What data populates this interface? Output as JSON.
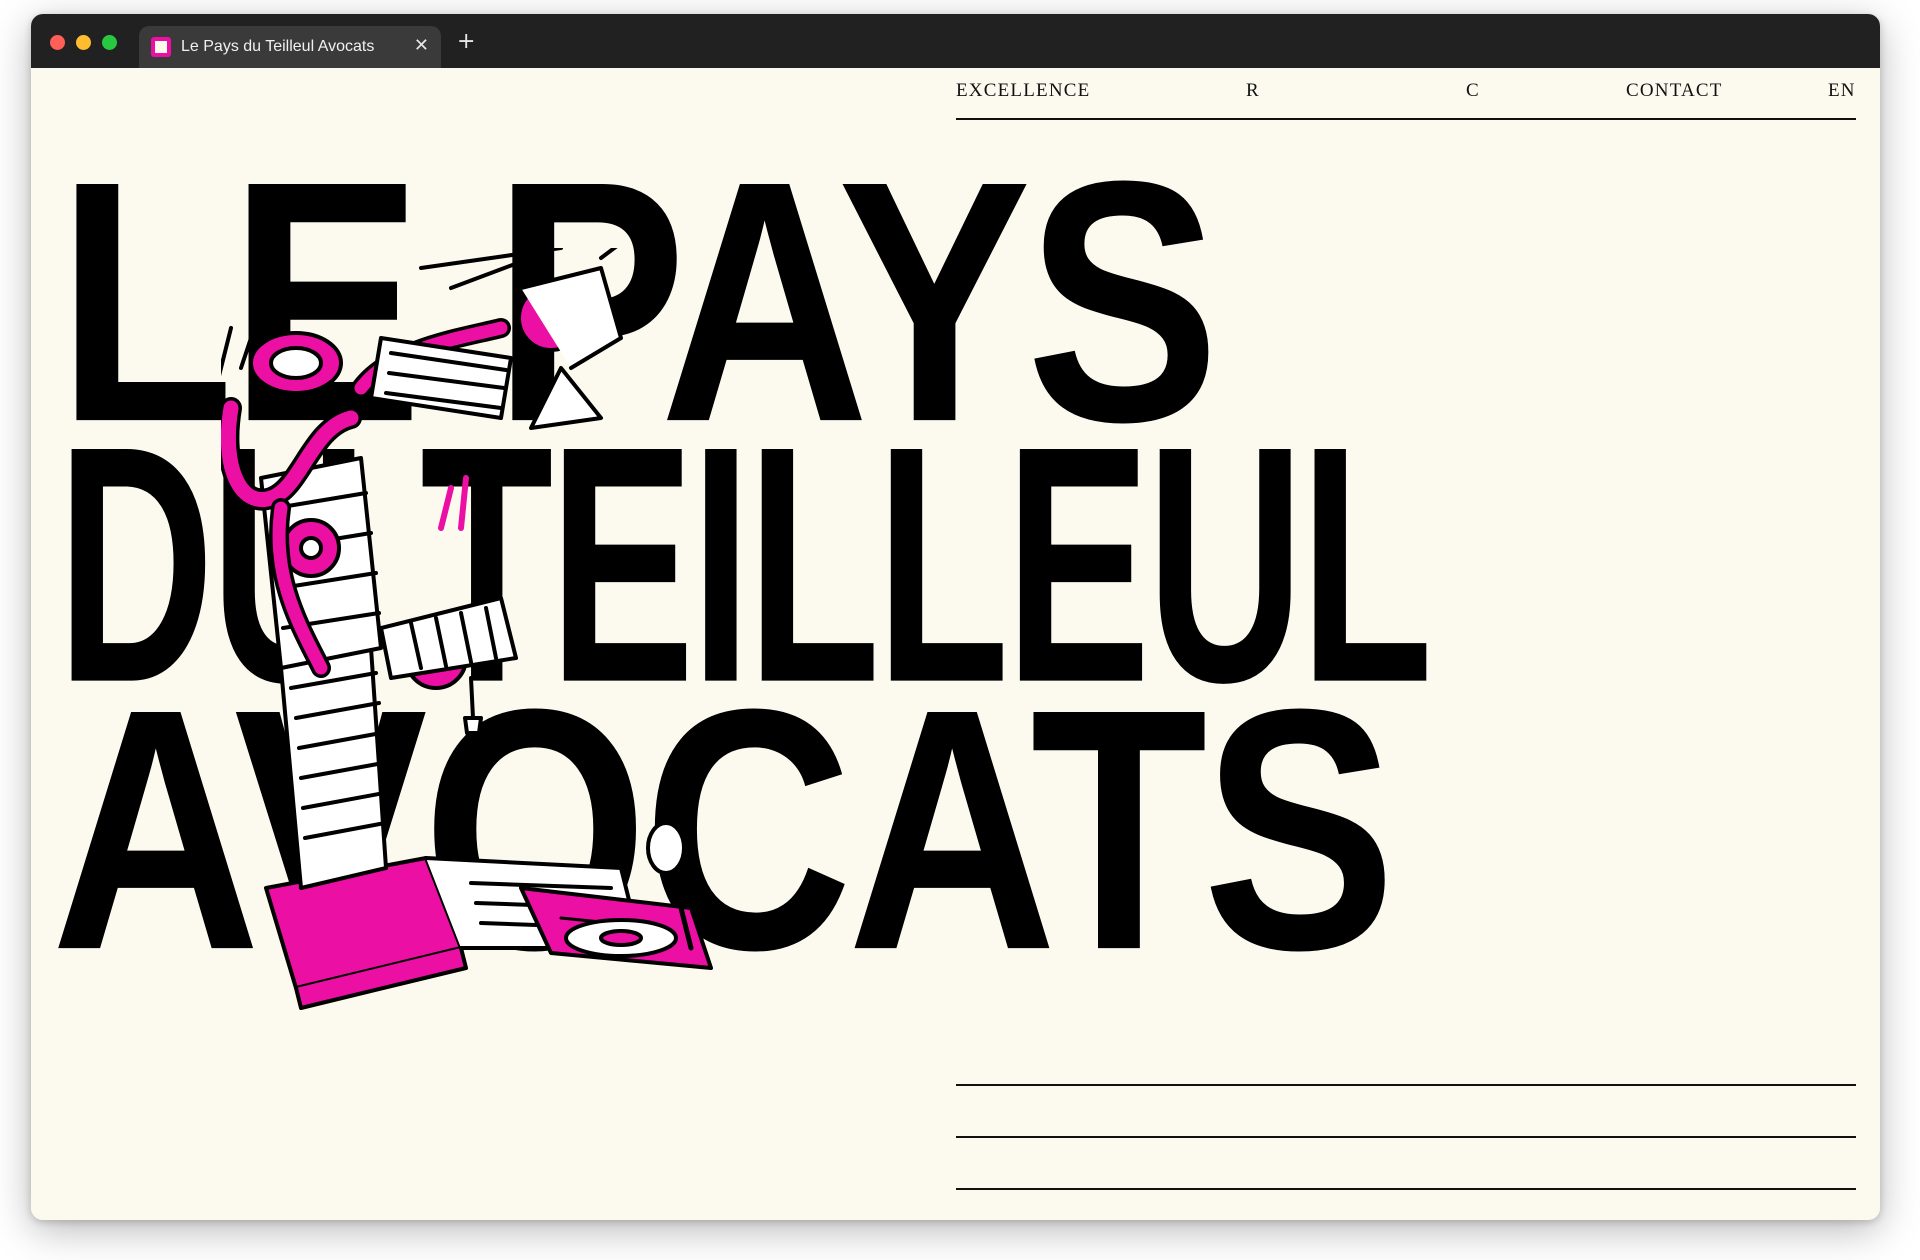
{
  "browser": {
    "tab_title": "Le Pays du Teilleul  Avocats",
    "tab_close_glyph": "✕",
    "new_tab_glyph": "+",
    "favicon_color": "#ec0fa4"
  },
  "nav": {
    "items": [
      "EXCELLENCE",
      "R",
      "C",
      "CONTACT",
      "EN"
    ]
  },
  "hero": {
    "line1": "LE PAYS",
    "line2": "DU TEILLEUL",
    "line3": "AVOCATS"
  },
  "colors": {
    "background": "#fcfaee",
    "text": "#000000",
    "accent": "#ec0fa4"
  },
  "illustration": {
    "icon": "robotic-arm-collage-illustration"
  }
}
